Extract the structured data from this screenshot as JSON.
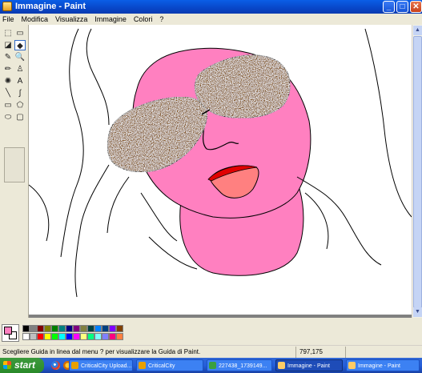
{
  "window": {
    "title": "Immagine - Paint",
    "buttons": {
      "minimize": "_",
      "maximize": "□",
      "close": "✕"
    }
  },
  "menu": [
    "File",
    "Modifica",
    "Visualizza",
    "Immagine",
    "Colori",
    "?"
  ],
  "tools": [
    {
      "name": "free-select-icon",
      "glyph": "⬚"
    },
    {
      "name": "rect-select-icon",
      "glyph": "▭"
    },
    {
      "name": "eraser-icon",
      "glyph": "◪"
    },
    {
      "name": "fill-bucket-icon",
      "glyph": "◆",
      "selected": true
    },
    {
      "name": "color-picker-icon",
      "glyph": "✎"
    },
    {
      "name": "magnifier-icon",
      "glyph": "🔍"
    },
    {
      "name": "pencil-icon",
      "glyph": "✏"
    },
    {
      "name": "brush-icon",
      "glyph": "♙"
    },
    {
      "name": "airbrush-icon",
      "glyph": "✺"
    },
    {
      "name": "text-icon",
      "glyph": "A"
    },
    {
      "name": "line-icon",
      "glyph": "╲"
    },
    {
      "name": "curve-icon",
      "glyph": "∫"
    },
    {
      "name": "rectangle-icon",
      "glyph": "▭"
    },
    {
      "name": "polygon-icon",
      "glyph": "⬠"
    },
    {
      "name": "ellipse-icon",
      "glyph": "⬭"
    },
    {
      "name": "rounded-rect-icon",
      "glyph": "▢"
    }
  ],
  "colors": {
    "foreground": "#ff80c0",
    "background": "#ffffff",
    "palette": [
      "#000000",
      "#808080",
      "#800000",
      "#808000",
      "#008000",
      "#008080",
      "#000080",
      "#800080",
      "#808040",
      "#004040",
      "#0080ff",
      "#004080",
      "#8000ff",
      "#804000",
      "#ffffff",
      "#c0c0c0",
      "#ff0000",
      "#ffff00",
      "#00ff00",
      "#00ffff",
      "#0000ff",
      "#ff00ff",
      "#ffff80",
      "#00ff80",
      "#80ffff",
      "#8080ff",
      "#ff0080",
      "#ff8040"
    ]
  },
  "status": {
    "text": "Scegliere Guida in linea dal menu ? per visualizzare la Guida di Paint.",
    "coords": "797,175"
  },
  "taskbar": {
    "start_label": "start",
    "tasks": [
      {
        "label": "CriticalCity Upload...",
        "icon_color": "#e8a000",
        "active": false
      },
      {
        "label": "CriticalCity",
        "icon_color": "#e8a000",
        "active": false
      },
      {
        "label": "227438_1739149...",
        "icon_color": "#3aa040",
        "active": false
      },
      {
        "label": "Immagine - Paint",
        "icon_color": "#ffcc66",
        "active": true
      },
      {
        "label": "Immagine - Paint",
        "icon_color": "#ffcc66",
        "active": false
      }
    ]
  }
}
